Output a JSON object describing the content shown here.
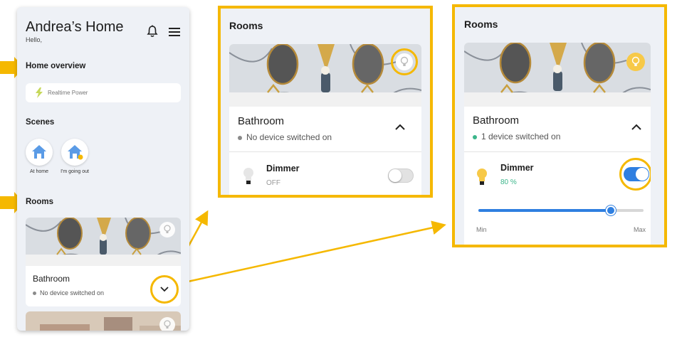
{
  "phone": {
    "title": "Andrea’s Home",
    "greeting": "Hello,",
    "home_overview_heading": "Home overview",
    "realtime_power_label": "Realtime Power",
    "scenes_heading": "Scenes",
    "scenes": [
      {
        "label": "At home",
        "icon": "home-icon"
      },
      {
        "label": "I'm going out",
        "icon": "home-away-icon"
      }
    ],
    "rooms_heading": "Rooms",
    "room": {
      "name": "Bathroom",
      "status": "No device switched on"
    }
  },
  "panel_off": {
    "heading": "Rooms",
    "room_name": "Bathroom",
    "room_status": "No device switched on",
    "device_name": "Dimmer",
    "device_state": "OFF",
    "toggle_on": false
  },
  "panel_on": {
    "heading": "Rooms",
    "room_name": "Bathroom",
    "room_status": "1 device switched on",
    "device_name": "Dimmer",
    "device_state": "80 %",
    "toggle_on": true,
    "slider_value_percent": 80,
    "slider_min_label": "Min",
    "slider_max_label": "Max"
  },
  "colors": {
    "highlight": "#f5b800",
    "toggle_on": "#2f7fe0",
    "status_on_dot": "#3bb58a",
    "status_off_dot": "#8a8a8a",
    "background": "#eef1f6"
  }
}
